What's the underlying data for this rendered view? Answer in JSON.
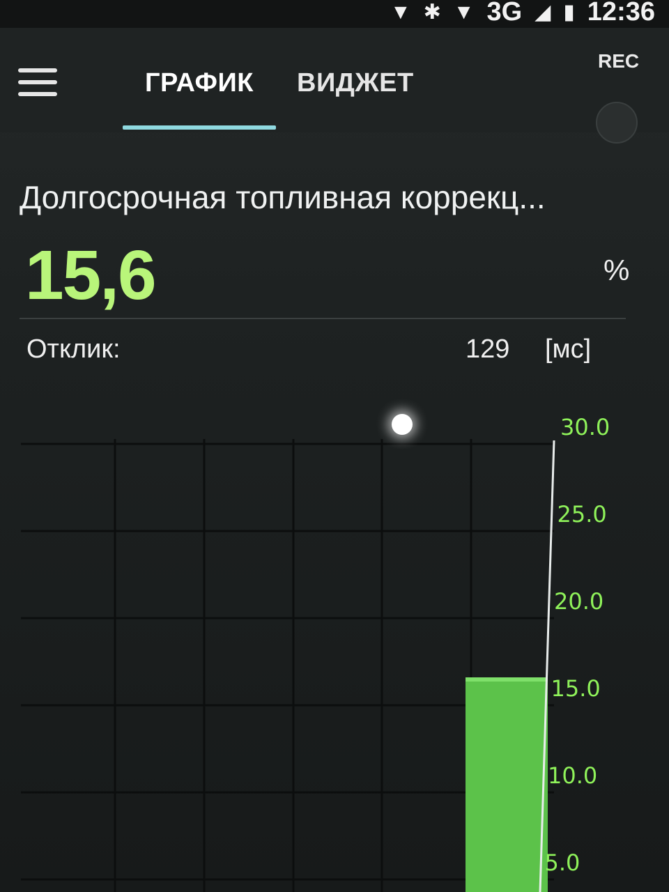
{
  "status_bar": {
    "network": "3G",
    "time": "12:36"
  },
  "tabs": [
    {
      "label": "ГРАФИК",
      "active": true
    },
    {
      "label": "ВИДЖЕТ",
      "active": false
    }
  ],
  "rec": {
    "label": "REC"
  },
  "parameter": {
    "name": "Долгосрочная топливная коррекц...",
    "value": "15,6",
    "unit": "%"
  },
  "response": {
    "label": "Отклик:",
    "value": "129",
    "unit": "[мс]"
  },
  "colors": {
    "accent_green": "#b9f57a",
    "bar_green": "#5cc24a",
    "tick_green": "#8ff25a",
    "tab_indicator": "#8fd9e0"
  },
  "chart_data": {
    "type": "bar",
    "categories": [
      ""
    ],
    "values": [
      15.6
    ],
    "y_ticks": [
      "30.0",
      "25.0",
      "20.0",
      "15.0",
      "10.0",
      "5.0"
    ],
    "y_tick_values": [
      30,
      25,
      20,
      15,
      10,
      5
    ],
    "ylim": [
      0,
      30
    ],
    "grid": true,
    "title": "",
    "xlabel": "",
    "ylabel": ""
  }
}
